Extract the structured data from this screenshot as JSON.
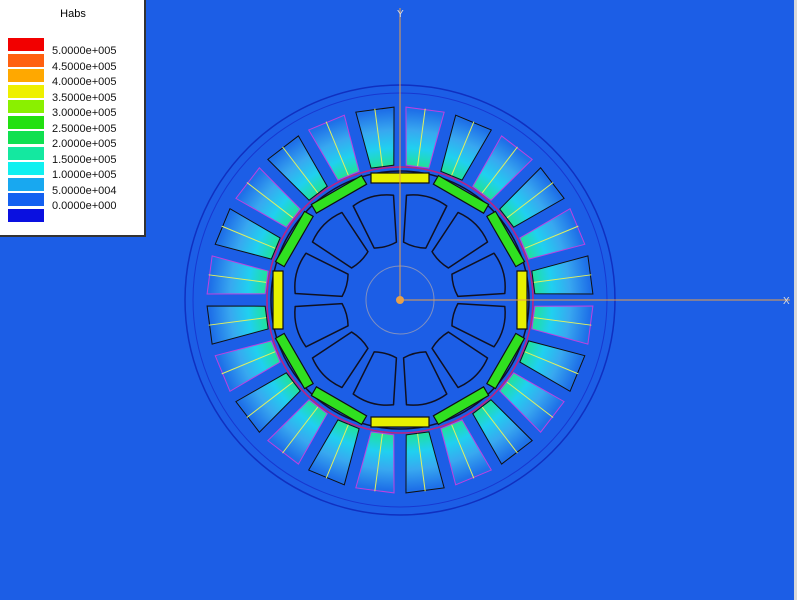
{
  "viewport": {
    "background": "#1c5ee6",
    "axis_x_label": "X",
    "axis_y_label": "Y",
    "axis_color": "#e8a04a"
  },
  "legend": {
    "title": "Habs",
    "entries": [
      {
        "label": "5.0000e+005",
        "color": "#f20000"
      },
      {
        "label": "4.5000e+005",
        "color": "#ff6010"
      },
      {
        "label": "4.0000e+005",
        "color": "#ffa800"
      },
      {
        "label": "3.5000e+005",
        "color": "#eef000"
      },
      {
        "label": "3.0000e+005",
        "color": "#8af000"
      },
      {
        "label": "2.5000e+005",
        "color": "#22e010"
      },
      {
        "label": "2.0000e+005",
        "color": "#10e050"
      },
      {
        "label": "1.5000e+005",
        "color": "#14e8a0"
      },
      {
        "label": "1.0000e+005",
        "color": "#10f0f0"
      },
      {
        "label": "5.0000e+004",
        "color": "#18a8f0"
      },
      {
        "label": "0.0000e+000",
        "color": "#1460f0"
      },
      {
        "label": "",
        "color": "#0a10e0"
      }
    ]
  },
  "model": {
    "stator_slots": 24,
    "rotor_magnets": 12,
    "rotor_holes": 12
  }
}
